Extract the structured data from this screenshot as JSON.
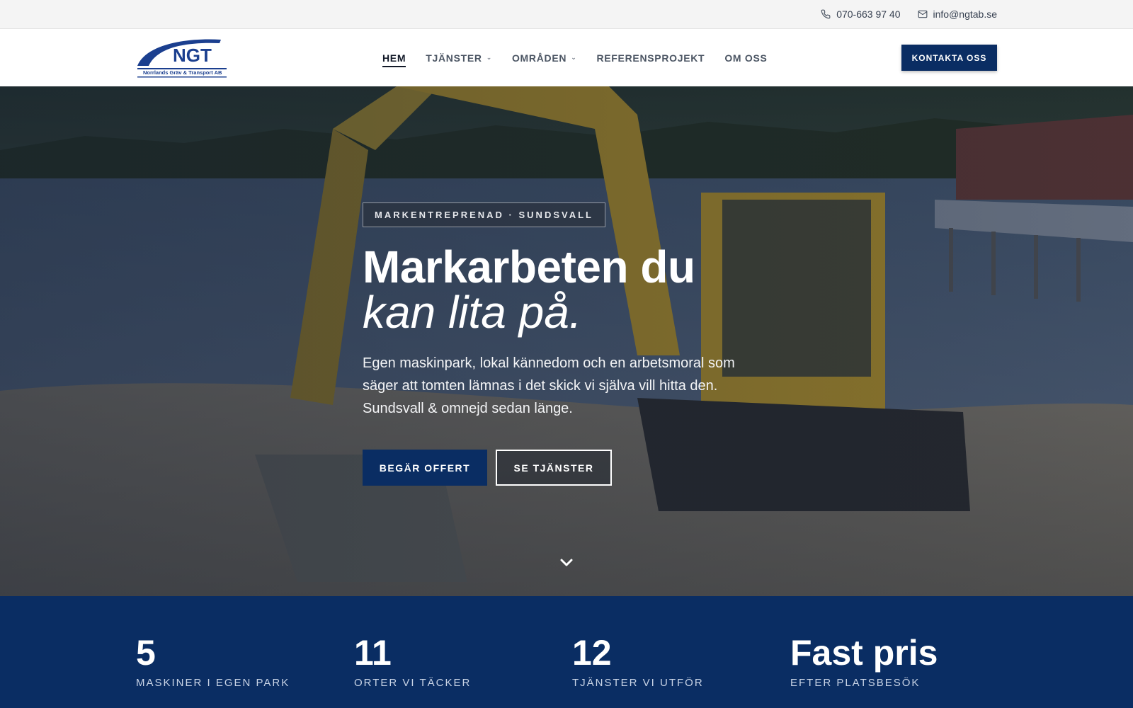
{
  "topbar": {
    "phone": "070-663 97 40",
    "email": "info@ngtab.se"
  },
  "header": {
    "logo": {
      "text": "NGT",
      "subtext": "Norrlands Gräv & Transport AB"
    },
    "nav": [
      {
        "label": "HEM",
        "active": true,
        "has_dropdown": false
      },
      {
        "label": "TJÄNSTER",
        "active": false,
        "has_dropdown": true
      },
      {
        "label": "OMRÅDEN",
        "active": false,
        "has_dropdown": true
      },
      {
        "label": "REFERENSPROJEKT",
        "active": false,
        "has_dropdown": false
      },
      {
        "label": "OM OSS",
        "active": false,
        "has_dropdown": false
      }
    ],
    "cta_label": "KONTAKTA OSS"
  },
  "hero": {
    "eyebrow": "MARKENTREPRENAD · SUNDSVALL",
    "title_line1": "Markarbeten du",
    "title_line2": "kan lita på.",
    "lead": "Egen maskinpark, lokal kännedom och en arbetsmoral som säger att tomten lämnas i det skick vi själva vill hitta den. Sundsvall & omnejd sedan länge.",
    "primary_button": "BEGÄR OFFERT",
    "secondary_button": "SE TJÄNSTER"
  },
  "stats": [
    {
      "value": "5",
      "label": "MASKINER I EGEN PARK"
    },
    {
      "value": "11",
      "label": "ORTER VI TÄCKER"
    },
    {
      "value": "12",
      "label": "TJÄNSTER VI UTFÖR"
    },
    {
      "value": "Fast pris",
      "label": "EFTER PLATSBESÖK"
    }
  ],
  "colors": {
    "brand_navy": "#0a2d63",
    "topbar_bg": "#f4f4f4",
    "machine_yellow": "#c9a227"
  },
  "icons": {
    "phone": "phone-icon",
    "email": "mail-icon",
    "dropdown": "chevron-down-icon",
    "scroll": "chevron-down-icon"
  }
}
